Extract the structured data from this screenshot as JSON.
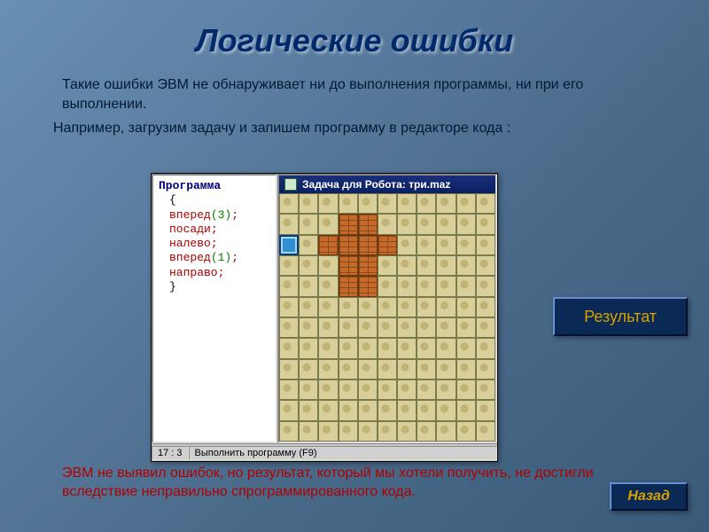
{
  "title": "Логические ошибки",
  "intro": "Такие ошибки ЭВМ не обнаруживает ни до выполнения программы, ни при его выполнении.",
  "example": "Например, загрузим  задачу и запишем программу в редакторе кода :",
  "code": {
    "header": "Программа",
    "open": "{",
    "l1_cmd": "вперед",
    "l1_arg": "(3)",
    "semi": ";",
    "l2_cmd": "посади",
    "l3_cmd": "налево",
    "l4_cmd": "вперед",
    "l4_arg": "(1)",
    "l5_cmd": "направо",
    "close": "}"
  },
  "robot": {
    "title": "Задача для Робота: три.maz"
  },
  "statusbar": {
    "pos": "17 : 3",
    "hint": "Выполнить программу (F9)"
  },
  "result_label": "Результат",
  "footer": "ЭВМ не выявил ошибок, но результат, который мы хотели получить, не достигли  вследствие  неправильно  спрограммированного  кода.",
  "back_label": "Назад",
  "walls": [
    {
      "r": 2,
      "c": 4
    },
    {
      "r": 2,
      "c": 5
    },
    {
      "r": 3,
      "c": 3
    },
    {
      "r": 3,
      "c": 4
    },
    {
      "r": 3,
      "c": 5
    },
    {
      "r": 3,
      "c": 6
    },
    {
      "r": 4,
      "c": 4
    },
    {
      "r": 4,
      "c": 5
    },
    {
      "r": 5,
      "c": 4
    },
    {
      "r": 5,
      "c": 5
    }
  ],
  "robot_cell": {
    "r": 3,
    "c": 1
  }
}
